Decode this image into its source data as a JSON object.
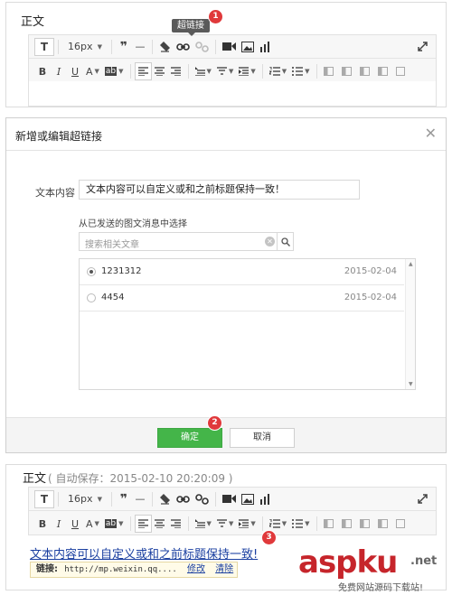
{
  "editor_top": {
    "title": "正文",
    "tooltip": "超链接",
    "badge": "1",
    "font_size": "16px"
  },
  "toolbar_icons_row1": [
    "text-icon",
    "font-size-select",
    "quote-icon",
    "horizontal-rule-icon",
    "clear-format-icon",
    "link-icon",
    "unlink-icon",
    "video-icon",
    "image-icon",
    "chart-icon",
    "fullscreen-icon"
  ],
  "toolbar_icons_row2": [
    "bold-icon",
    "italic-icon",
    "underline-icon",
    "font-color-icon",
    "background-color-icon",
    "align-left-icon",
    "align-center-icon",
    "align-right-icon",
    "row-spacing-icon",
    "paragraph-spacing-icon",
    "indent-icon",
    "ordered-list-icon",
    "unordered-list-icon",
    "table-icons"
  ],
  "toolbar_glyphs": {
    "T": "T",
    "quote": "❞",
    "hr": "—",
    "B": "B",
    "I": "I",
    "U": "U",
    "A": "A",
    "ab": "ab"
  },
  "dialog": {
    "title": "新增或编辑超链接",
    "text_label": "文本内容",
    "text_value": "文本内容可以自定义或和之前标题保持一致！",
    "select_label": "从已发送的图文消息中选择",
    "search_placeholder": "搜索相关文章",
    "articles": [
      {
        "name": "1231312",
        "date": "2015-02-04",
        "selected": true
      },
      {
        "name": "4454",
        "date": "2015-02-04",
        "selected": false
      }
    ],
    "ok_label": "确定",
    "cancel_label": "取消",
    "badge": "2"
  },
  "editor_bottom": {
    "title": "正文",
    "autosave": "( 自动保存：2015-02-10 20:20:09 )",
    "font_size": "16px",
    "link_text": "文本内容可以自定义或和之前标题保持一致!",
    "badge": "3",
    "link_popup": {
      "label": "链接:",
      "url": "http://mp.weixin.qq....",
      "edit": "修改",
      "clear": "清除"
    }
  },
  "watermark": {
    "brand": "aspku",
    "net": ".net",
    "sub": "免费网站源码下载站!"
  },
  "colors": {
    "confirm_green": "#44b549",
    "badge_red": "#e0393b",
    "link_blue": "#1a3fa0",
    "watermark_red": "#c6252b"
  }
}
